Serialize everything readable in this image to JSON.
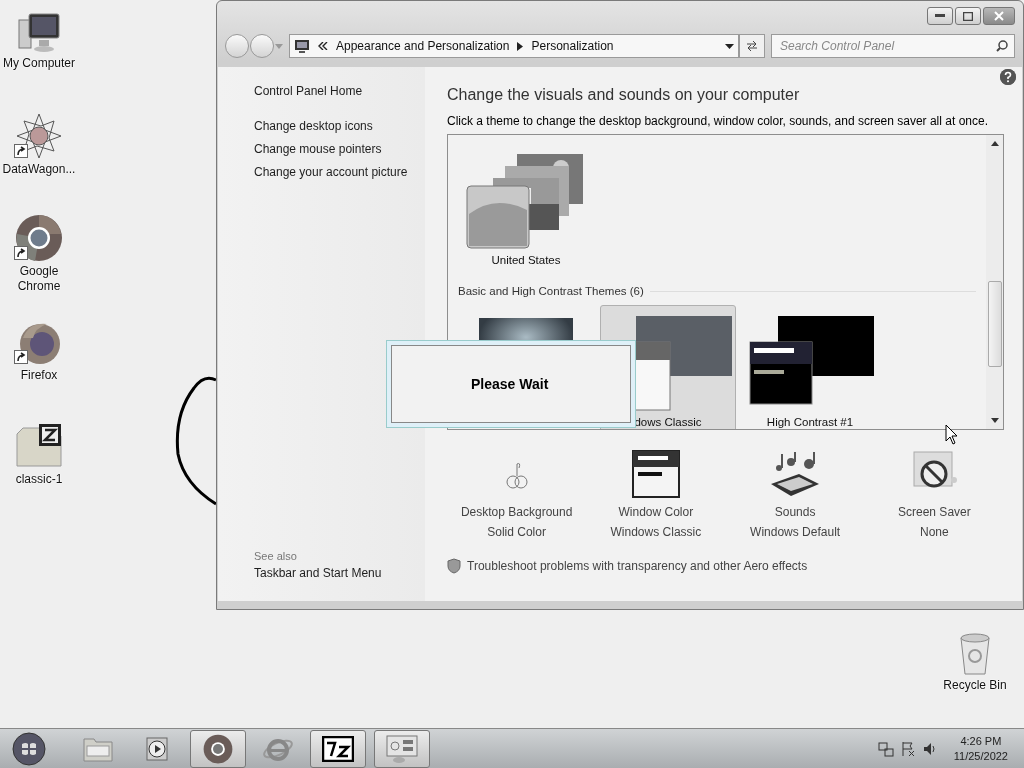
{
  "desktop_icons": [
    {
      "label": "My Computer",
      "kind": "computer"
    },
    {
      "label": "DataWagon...",
      "kind": "star",
      "shortcut": true
    },
    {
      "label": "Google Chrome",
      "kind": "chrome",
      "shortcut": true
    },
    {
      "label": "Firefox",
      "kind": "firefox",
      "shortcut": true
    },
    {
      "label": "classic-1",
      "kind": "archive"
    }
  ],
  "recycle_bin": {
    "label": "Recycle Bin"
  },
  "window": {
    "breadcrumb": [
      "Appearance and Personalization",
      "Personalization"
    ],
    "search": {
      "placeholder": "Search Control Panel"
    },
    "sidebar": {
      "links": [
        "Control Panel Home",
        "Change desktop icons",
        "Change mouse pointers",
        "Change your account picture"
      ],
      "see_also": {
        "heading": "See also",
        "links": [
          "Taskbar and Start Menu"
        ]
      }
    },
    "title": "Change the visuals and sounds on your computer",
    "description": "Click a theme to change the desktop background, window color, sounds, and screen saver all at once.",
    "theme_groups": [
      {
        "items": [
          {
            "label": "United States",
            "selected": false
          }
        ]
      },
      {
        "heading": "Basic and High Contrast Themes (6)",
        "items": [
          {
            "kind": "basic",
            "selected": false
          },
          {
            "label": "dows Classic",
            "kind": "classic",
            "selected": true
          },
          {
            "label": "High Contrast #1",
            "kind": "contrast",
            "selected": false
          }
        ]
      }
    ],
    "settings": [
      {
        "title": "Desktop Background",
        "value": "Solid Color",
        "kind": "background"
      },
      {
        "title": "Window Color",
        "value": "Windows Classic",
        "kind": "color"
      },
      {
        "title": "Sounds",
        "value": "Windows Default",
        "kind": "sounds"
      },
      {
        "title": "Screen Saver",
        "value": "None",
        "kind": "saver"
      }
    ],
    "troubleshoot": "Troubleshoot problems with transparency and other Aero effects"
  },
  "dialog": {
    "message": "Please Wait"
  },
  "taskbar": {
    "items": [
      {
        "kind": "explorer",
        "selected": false
      },
      {
        "kind": "media",
        "selected": false
      },
      {
        "kind": "chrome",
        "selected": true
      },
      {
        "kind": "ie",
        "selected": false
      },
      {
        "kind": "archiver",
        "selected": true
      },
      {
        "kind": "control",
        "selected": true
      }
    ],
    "time": "4:26 PM",
    "date": "11/25/2022"
  }
}
